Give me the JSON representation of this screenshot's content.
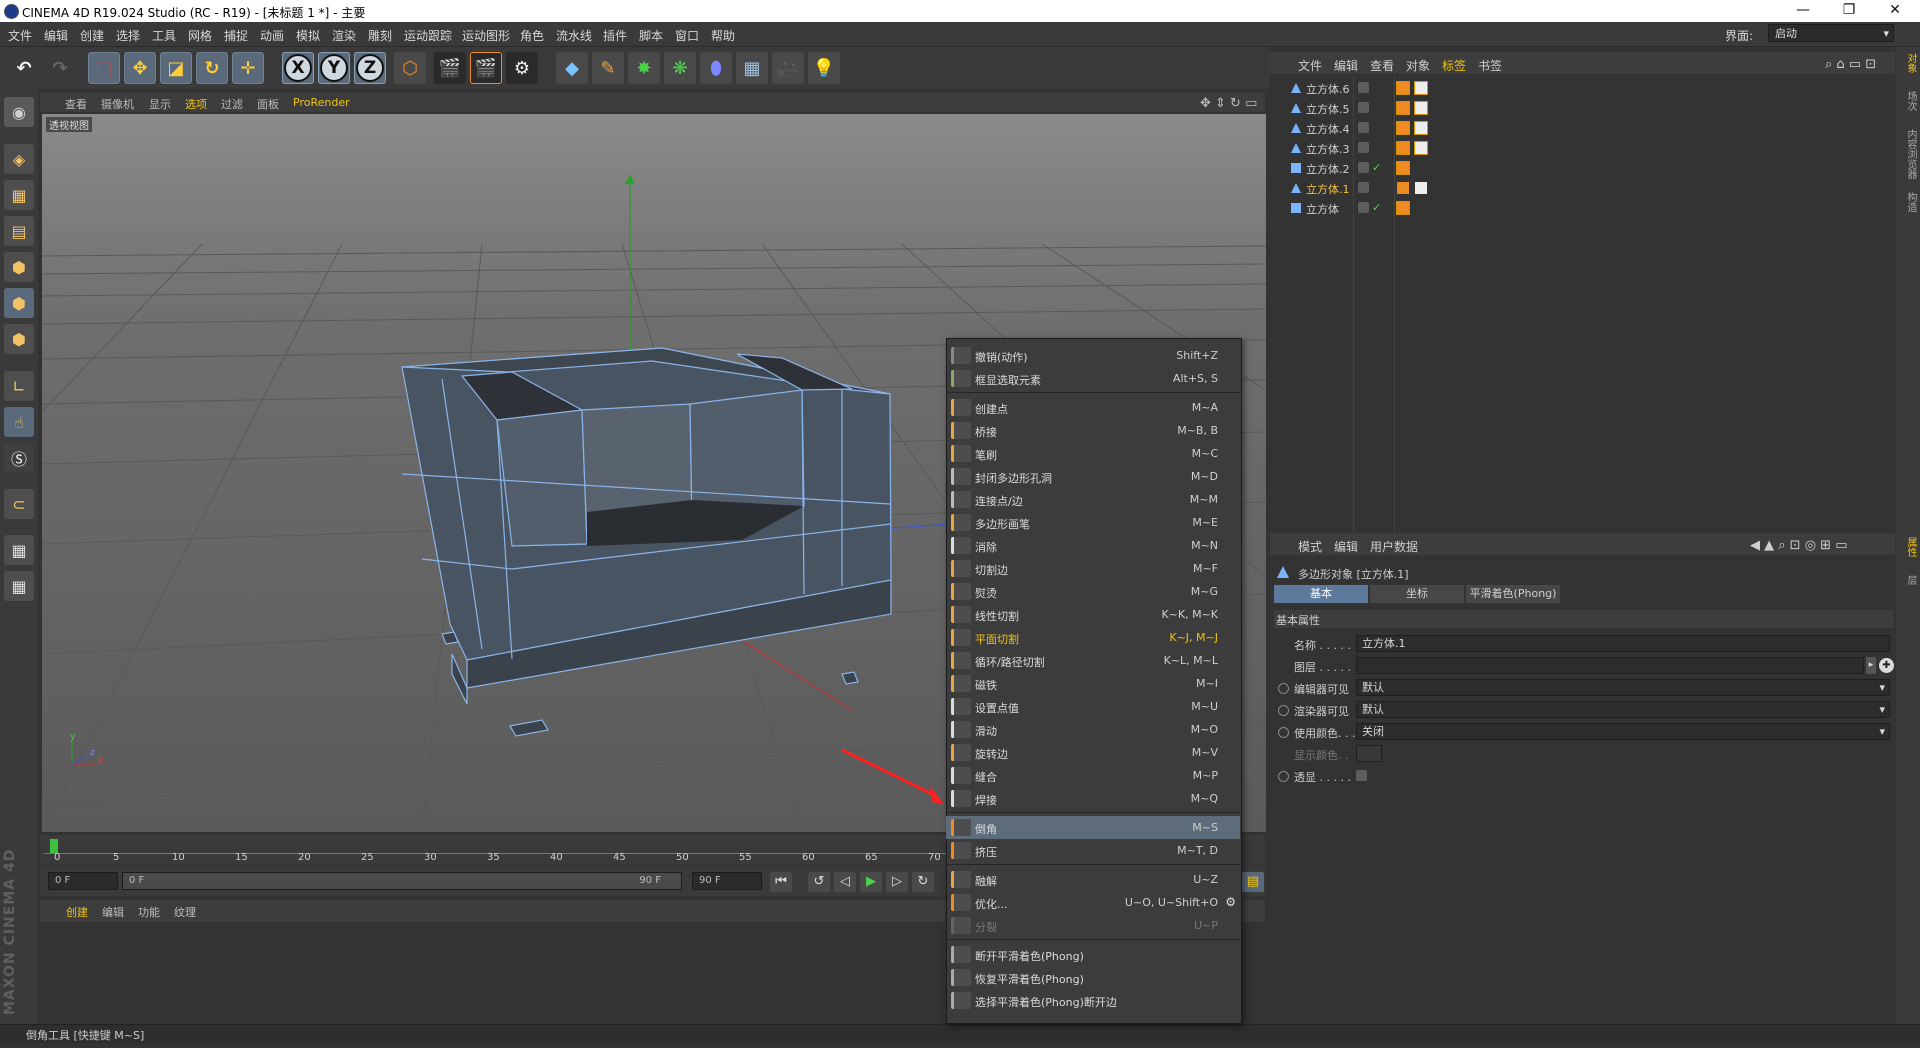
{
  "window": {
    "title": "CINEMA 4D R19.024 Studio (RC - R19) - [未标题 1 *] - 主要",
    "min": "—",
    "restore": "❐",
    "close": "✕"
  },
  "menubar": {
    "items": [
      "文件",
      "编辑",
      "创建",
      "选择",
      "工具",
      "网格",
      "捕捉",
      "动画",
      "模拟",
      "渲染",
      "雕刻",
      "运动跟踪",
      "运动图形",
      "角色",
      "流水线",
      "插件",
      "脚本",
      "窗口",
      "帮助"
    ],
    "layout_label": "界面:",
    "layout_value": "启动"
  },
  "toolbar": {
    "x": "X",
    "y": "Y",
    "z": "Z"
  },
  "viewport": {
    "menu": [
      "查看",
      "摄像机",
      "显示",
      "选项",
      "过滤",
      "面板",
      "ProRender"
    ],
    "label": "透视视图",
    "axis_x": "x",
    "axis_y": "y",
    "axis_z": "z"
  },
  "timeline": {
    "ticks": [
      "0",
      "5",
      "10",
      "15",
      "20",
      "25",
      "30",
      "35",
      "40",
      "45",
      "50",
      "55",
      "60",
      "65",
      "70"
    ],
    "start": "0 F",
    "range_start": "0 F",
    "range_end": "90 F",
    "end": "90 F"
  },
  "materials": {
    "menu": [
      "创建",
      "编辑",
      "功能",
      "纹理"
    ],
    "logo": "MAXON CINEMA 4D"
  },
  "status": "倒角工具 [快捷键 M~S]",
  "object_manager": {
    "menu": [
      "文件",
      "编辑",
      "查看",
      "对象",
      "标签",
      "书签"
    ],
    "objects": [
      {
        "name": "立方体.6",
        "selected": false
      },
      {
        "name": "立方体.5",
        "selected": false
      },
      {
        "name": "立方体.4",
        "selected": false
      },
      {
        "name": "立方体.3",
        "selected": false
      },
      {
        "name": "立方体.2",
        "selected": false
      },
      {
        "name": "立方体.1",
        "selected": true
      },
      {
        "name": "立方体",
        "selected": false
      }
    ],
    "check": "✓"
  },
  "attribute_manager": {
    "menu": [
      "模式",
      "编辑",
      "用户数据"
    ],
    "object_title": "多边形对象 [立方体.1]",
    "tabs": [
      "基本",
      "坐标",
      "平滑着色(Phong)"
    ],
    "section": "基本属性",
    "fields": {
      "name_label": "名称 . . . . .",
      "name_value": "立方体.1",
      "layer_label": "图层 . . . . .",
      "editor_vis_label": "编辑器可见",
      "editor_vis_value": "默认",
      "render_vis_label": "渲染器可见",
      "render_vis_value": "默认",
      "use_color_label": "使用颜色. . .",
      "use_color_value": "关闭",
      "display_color_label": "显示颜色. .",
      "xray_label": "透显 . . . . ."
    }
  },
  "right_strip": [
    "对象",
    "场次",
    "内容浏览器",
    "构造",
    "属性",
    "层"
  ],
  "context_menu": {
    "groups": [
      [
        {
          "label": "撤销(动作)",
          "key": "Shift+Z",
          "style": "normal"
        },
        {
          "label": "框显选取元素",
          "key": "Alt+S, S",
          "style": "normal"
        }
      ],
      [
        {
          "label": "创建点",
          "key": "M~A",
          "style": "normal"
        },
        {
          "label": "桥接",
          "key": "M~B, B",
          "style": "normal"
        },
        {
          "label": "笔刷",
          "key": "M~C",
          "style": "normal"
        },
        {
          "label": "封闭多边形孔洞",
          "key": "M~D",
          "style": "normal"
        },
        {
          "label": "连接点/边",
          "key": "M~M",
          "style": "normal"
        },
        {
          "label": "多边形画笔",
          "key": "M~E",
          "style": "normal"
        },
        {
          "label": "消除",
          "key": "M~N",
          "style": "normal"
        },
        {
          "label": "切割边",
          "key": "M~F",
          "style": "normal"
        },
        {
          "label": "熨烫",
          "key": "M~G",
          "style": "normal"
        },
        {
          "label": "线性切割",
          "key": "K~K, M~K",
          "style": "normal"
        },
        {
          "label": "平面切割",
          "key": "K~J, M~J",
          "style": "yellow"
        },
        {
          "label": "循环/路径切割",
          "key": "K~L, M~L",
          "style": "normal"
        },
        {
          "label": "磁铁",
          "key": "M~I",
          "style": "normal"
        },
        {
          "label": "设置点值",
          "key": "M~U",
          "style": "normal"
        },
        {
          "label": "滑动",
          "key": "M~O",
          "style": "normal"
        },
        {
          "label": "旋转边",
          "key": "M~V",
          "style": "normal"
        },
        {
          "label": "缝合",
          "key": "M~P",
          "style": "normal"
        },
        {
          "label": "焊接",
          "key": "M~Q",
          "style": "normal"
        }
      ],
      [
        {
          "label": "倒角",
          "key": "M~S",
          "style": "highlight"
        },
        {
          "label": "挤压",
          "key": "M~T, D",
          "style": "normal"
        }
      ],
      [
        {
          "label": "融解",
          "key": "U~Z",
          "style": "normal"
        },
        {
          "label": "优化...",
          "key": "U~O, U~Shift+O",
          "style": "normal"
        },
        {
          "label": "分裂",
          "key": "U~P",
          "style": "disabled"
        }
      ],
      [
        {
          "label": "断开平滑着色(Phong)",
          "key": "",
          "style": "normal"
        },
        {
          "label": "恢复平滑着色(Phong)",
          "key": "",
          "style": "normal"
        },
        {
          "label": "选择平滑着色(Phong)断开边",
          "key": "",
          "style": "normal"
        }
      ]
    ]
  },
  "colors": {
    "accent": "#f1c40f",
    "highlight": "#5d6b7b",
    "selection": "#f0c040",
    "viewport_bg": "#6a6a6a"
  }
}
